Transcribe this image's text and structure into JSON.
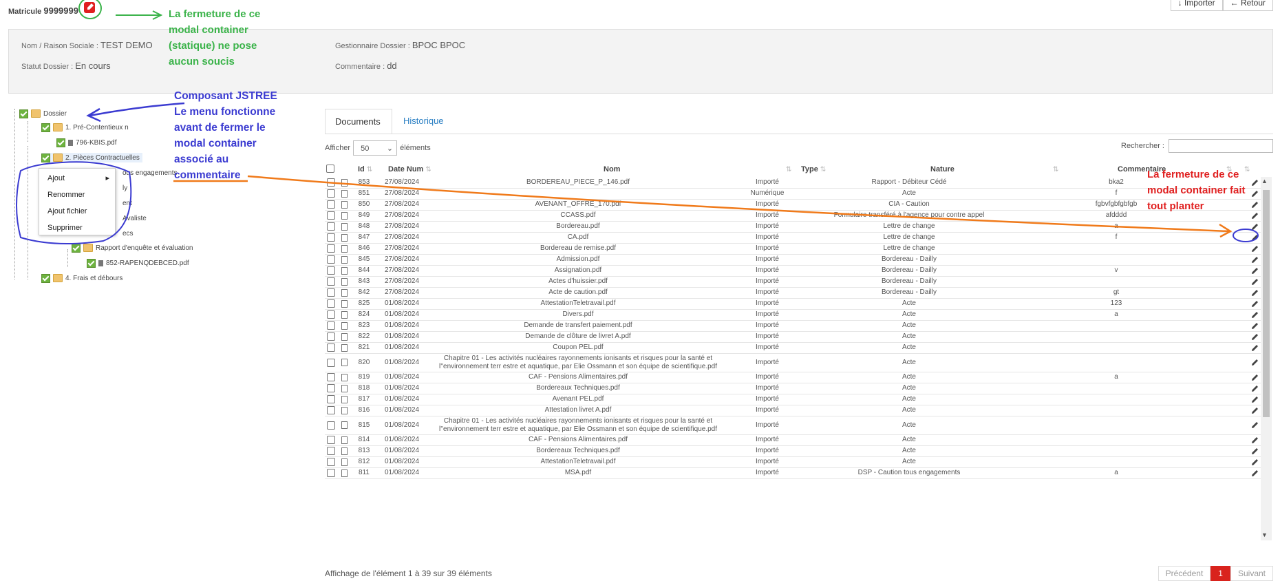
{
  "header": {
    "matricule_label": "Matricule",
    "matricule_value": "9999999",
    "buttons": [
      "Importer",
      "Retour"
    ]
  },
  "info": {
    "nom_label": "Nom / Raison Sociale",
    "nom_value": "TEST DEMO",
    "statut_label": "Statut Dossier",
    "statut_value": "En cours",
    "gestionnaire_label": "Gestionnaire Dossier",
    "gestionnaire_value": "BPOC BPOC",
    "commentaire_label": "Commentaire",
    "commentaire_value": "dd"
  },
  "tree": {
    "nodes": [
      "Dossier",
      "1. Pré-Contentieux n",
      "796-KBIS.pdf",
      "2. Pièces Contractuelles",
      "ous engagements",
      "ly",
      "ent",
      "Avaliste",
      "ecs",
      "Rapport d'enquête et évaluation",
      "852-RAPENQDEBCED.pdf",
      "4. Frais et débours"
    ]
  },
  "context_menu": {
    "items": [
      "Ajout",
      "Renommer",
      "Ajout fichier",
      "Supprimer"
    ]
  },
  "tabs": [
    "Documents",
    "Historique"
  ],
  "length": {
    "prefix": "Afficher",
    "value": "50",
    "suffix": "éléments"
  },
  "search": {
    "label": "Rechercher :"
  },
  "table": {
    "columns": [
      "Id",
      "Date Num",
      "Nom",
      "Type",
      "Nature",
      "Commentaire"
    ],
    "rows": [
      {
        "id": "853",
        "date": "27/08/2024",
        "nom": "BORDEREAU_PIECE_P_146.pdf",
        "type": "Importé",
        "nature": "Rapport - Débiteur Cédé",
        "comm": "bka2"
      },
      {
        "id": "851",
        "date": "27/08/2024",
        "nom": "",
        "type": "Numérique",
        "nature": "Acte",
        "comm": "f"
      },
      {
        "id": "850",
        "date": "27/08/2024",
        "nom": "AVENANT_OFFRE_170.pdf",
        "type": "Importé",
        "nature": "CIA - Caution",
        "comm": "fgbvfgbfgbfgb"
      },
      {
        "id": "849",
        "date": "27/08/2024",
        "nom": "CCASS.pdf",
        "type": "Importé",
        "nature": "Formulaire transféré à l'agence pour contre appel",
        "comm": "afdddd"
      },
      {
        "id": "848",
        "date": "27/08/2024",
        "nom": "Bordereau.pdf",
        "type": "Importé",
        "nature": "Lettre de change",
        "comm": "a"
      },
      {
        "id": "847",
        "date": "27/08/2024",
        "nom": "CA.pdf",
        "type": "Importé",
        "nature": "Lettre de change",
        "comm": "f"
      },
      {
        "id": "846",
        "date": "27/08/2024",
        "nom": "Bordereau de remise.pdf",
        "type": "Importé",
        "nature": "Lettre de change",
        "comm": ""
      },
      {
        "id": "845",
        "date": "27/08/2024",
        "nom": "Admission.pdf",
        "type": "Importé",
        "nature": "Bordereau - Dailly",
        "comm": ""
      },
      {
        "id": "844",
        "date": "27/08/2024",
        "nom": "Assignation.pdf",
        "type": "Importé",
        "nature": "Bordereau - Dailly",
        "comm": "v"
      },
      {
        "id": "843",
        "date": "27/08/2024",
        "nom": "Actes d'huissier.pdf",
        "type": "Importé",
        "nature": "Bordereau - Dailly",
        "comm": ""
      },
      {
        "id": "842",
        "date": "27/08/2024",
        "nom": "Acte de caution.pdf",
        "type": "Importé",
        "nature": "Bordereau - Dailly",
        "comm": "gt"
      },
      {
        "id": "825",
        "date": "01/08/2024",
        "nom": "AttestationTeletravail.pdf",
        "type": "Importé",
        "nature": "Acte",
        "comm": "123"
      },
      {
        "id": "824",
        "date": "01/08/2024",
        "nom": "Divers.pdf",
        "type": "Importé",
        "nature": "Acte",
        "comm": "a"
      },
      {
        "id": "823",
        "date": "01/08/2024",
        "nom": "Demande de transfert paiement.pdf",
        "type": "Importé",
        "nature": "Acte",
        "comm": ""
      },
      {
        "id": "822",
        "date": "01/08/2024",
        "nom": "Demande de clôture de livret A.pdf",
        "type": "Importé",
        "nature": "Acte",
        "comm": ""
      },
      {
        "id": "821",
        "date": "01/08/2024",
        "nom": "Coupon PEL.pdf",
        "type": "Importé",
        "nature": "Acte",
        "comm": ""
      },
      {
        "id": "820",
        "date": "01/08/2024",
        "nom": "Chapitre 01 - Les activités nucléaires rayonnements ionisants et risques pour la santé et l''environnement terr estre et aquatique, par Elie Ossmann et son équipe de scientifique.pdf",
        "type": "Importé",
        "nature": "Acte",
        "comm": ""
      },
      {
        "id": "819",
        "date": "01/08/2024",
        "nom": "CAF - Pensions Alimentaires.pdf",
        "type": "Importé",
        "nature": "Acte",
        "comm": "a"
      },
      {
        "id": "818",
        "date": "01/08/2024",
        "nom": "Bordereaux Techniques.pdf",
        "type": "Importé",
        "nature": "Acte",
        "comm": ""
      },
      {
        "id": "817",
        "date": "01/08/2024",
        "nom": "Avenant PEL.pdf",
        "type": "Importé",
        "nature": "Acte",
        "comm": ""
      },
      {
        "id": "816",
        "date": "01/08/2024",
        "nom": "Attestation livret A.pdf",
        "type": "Importé",
        "nature": "Acte",
        "comm": ""
      },
      {
        "id": "815",
        "date": "01/08/2024",
        "nom": "Chapitre 01 - Les activités nucléaires rayonnements ionisants et risques pour la santé et l''environnement terr estre et aquatique, par Elie Ossmann et son équipe de scientifique.pdf",
        "type": "Importé",
        "nature": "Acte",
        "comm": ""
      },
      {
        "id": "814",
        "date": "01/08/2024",
        "nom": "CAF - Pensions Alimentaires.pdf",
        "type": "Importé",
        "nature": "Acte",
        "comm": ""
      },
      {
        "id": "813",
        "date": "01/08/2024",
        "nom": "Bordereaux Techniques.pdf",
        "type": "Importé",
        "nature": "Acte",
        "comm": ""
      },
      {
        "id": "812",
        "date": "01/08/2024",
        "nom": "AttestationTeletravail.pdf",
        "type": "Importé",
        "nature": "Acte",
        "comm": ""
      },
      {
        "id": "811",
        "date": "01/08/2024",
        "nom": "MSA.pdf",
        "type": "Importé",
        "nature": "DSP - Caution tous engagements",
        "comm": "a"
      }
    ]
  },
  "footer": {
    "info": "Affichage de l'élément 1 à 39 sur 39 éléments",
    "pager": [
      "Précédent",
      "1",
      "Suivant"
    ]
  },
  "annotations": {
    "green": [
      "La fermeture de ce",
      "modal container",
      "(statique) ne pose",
      "aucun soucis"
    ],
    "blue": [
      "Composant JSTREE",
      "Le menu fonctionne",
      "avant de fermer le",
      "modal container",
      "associé au",
      "commentaire"
    ],
    "red": [
      "La fermeture de ce",
      "modal container fait",
      "tout planter"
    ]
  },
  "colors": {
    "annotation_green": "#3bb34a",
    "annotation_blue": "#3b3bd1",
    "annotation_red": "#e02020",
    "annotation_orange": "#f07a1a",
    "link": "#2a7fc3",
    "pager_active": "#d9231d"
  }
}
